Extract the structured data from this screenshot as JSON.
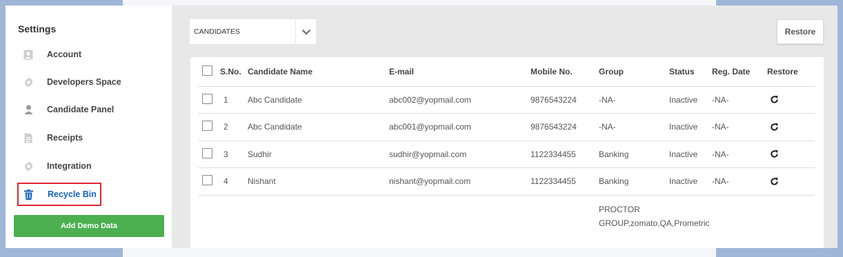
{
  "sidebar": {
    "title": "Settings",
    "items": [
      {
        "label": "Account",
        "icon": "account-icon"
      },
      {
        "label": "Developers Space",
        "icon": "gear-icon"
      },
      {
        "label": "Candidate Panel",
        "icon": "person-icon"
      },
      {
        "label": "Receipts",
        "icon": "receipt-icon"
      },
      {
        "label": "Integration",
        "icon": "puzzle-icon"
      },
      {
        "label": "Recycle Bin",
        "icon": "trash-icon",
        "active": true
      }
    ],
    "demo_button": "Add Demo Data"
  },
  "toolbar": {
    "dropdown_value": "CANDIDATES",
    "restore_label": "Restore"
  },
  "table": {
    "headers": [
      "S.No.",
      "Candidate Name",
      "E-mail",
      "Mobile No.",
      "Group",
      "Status",
      "Reg. Date",
      "Restore"
    ],
    "rows": [
      {
        "sno": "1",
        "name": "Abc Candidate",
        "email": "abc002@yopmail.com",
        "mobile": "9876543224",
        "group": "-NA-",
        "status": "Inactive",
        "reg_date": "-NA-"
      },
      {
        "sno": "2",
        "name": "Abc Candidate",
        "email": "abc001@yopmail.com",
        "mobile": "9876543224",
        "group": "-NA-",
        "status": "Inactive",
        "reg_date": "-NA-"
      },
      {
        "sno": "3",
        "name": "Sudhir",
        "email": "sudhir@yopmail.com",
        "mobile": "1122334455",
        "group": "Banking",
        "status": "Inactive",
        "reg_date": "-NA-"
      },
      {
        "sno": "4",
        "name": "Nishant",
        "email": "nishant@yopmail.com",
        "mobile": "1122334455",
        "group": "Banking",
        "status": "Inactive",
        "reg_date": "-NA-"
      }
    ],
    "partial_group": "PROCTOR GROUP,zomato,QA,Prometric"
  },
  "colors": {
    "accent_blue": "#1565c0",
    "active_border": "#e0282e",
    "demo_button": "#4caf50"
  }
}
